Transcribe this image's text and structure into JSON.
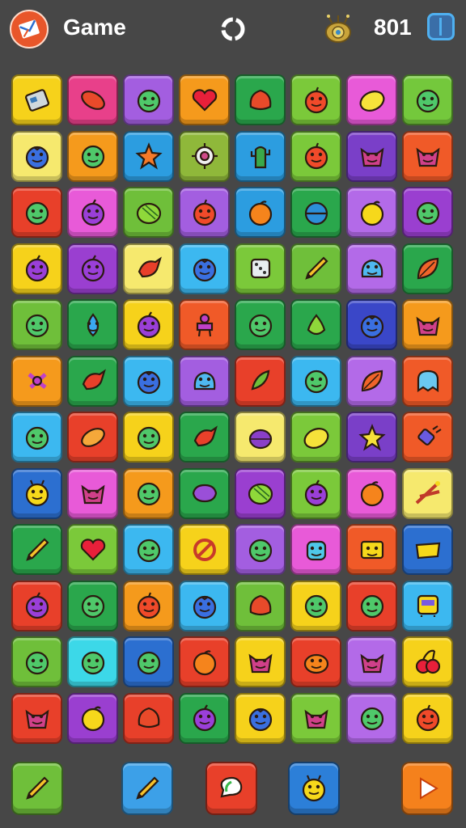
{
  "header": {
    "title": "Game",
    "coins": "801"
  },
  "board": {
    "rows": 12,
    "cols": 8,
    "tiles": [
      {
        "color": "#f6d21b",
        "icon": "robot"
      },
      {
        "color": "#e8408a",
        "icon": "fish"
      },
      {
        "color": "#a35ee0",
        "icon": "smiley"
      },
      {
        "color": "#f59a1c",
        "icon": "heart"
      },
      {
        "color": "#2aa74c",
        "icon": "leaf-creature"
      },
      {
        "color": "#7bc93a",
        "icon": "apple"
      },
      {
        "color": "#e85ad8",
        "icon": "lemon"
      },
      {
        "color": "#74c83c",
        "icon": "smiley"
      },
      {
        "color": "#f6e96e",
        "icon": "blueberry"
      },
      {
        "color": "#f59a1c",
        "icon": "smiley"
      },
      {
        "color": "#2c9de0",
        "icon": "star-creature"
      },
      {
        "color": "#8fb83a",
        "icon": "gear"
      },
      {
        "color": "#2c9de0",
        "icon": "cactus"
      },
      {
        "color": "#7bc93a",
        "icon": "apple"
      },
      {
        "color": "#7a3fc8",
        "icon": "cat"
      },
      {
        "color": "#f05a28",
        "icon": "cat"
      },
      {
        "color": "#e8402a",
        "icon": "smiley"
      },
      {
        "color": "#e85ad8",
        "icon": "plum"
      },
      {
        "color": "#6fbf3a",
        "icon": "melon"
      },
      {
        "color": "#a35ee0",
        "icon": "apple"
      },
      {
        "color": "#2c9de0",
        "icon": "orange"
      },
      {
        "color": "#2aa74c",
        "icon": "ball"
      },
      {
        "color": "#b36ae8",
        "icon": "lemon-round"
      },
      {
        "color": "#9a3fd0",
        "icon": "smiley"
      },
      {
        "color": "#f6d21b",
        "icon": "plum"
      },
      {
        "color": "#9a3fd0",
        "icon": "plum"
      },
      {
        "color": "#f6e96e",
        "icon": "bird"
      },
      {
        "color": "#3cb8f0",
        "icon": "blueberry"
      },
      {
        "color": "#7bc93a",
        "icon": "dice"
      },
      {
        "color": "#6fbf3a",
        "icon": "pencil"
      },
      {
        "color": "#b36ae8",
        "icon": "blob"
      },
      {
        "color": "#2aa74c",
        "icon": "leaf"
      },
      {
        "color": "#6fbf3a",
        "icon": "smiley"
      },
      {
        "color": "#2aa74c",
        "icon": "drop"
      },
      {
        "color": "#f6d21b",
        "icon": "plum"
      },
      {
        "color": "#f05a28",
        "icon": "robot-man"
      },
      {
        "color": "#2aa74c",
        "icon": "smiley"
      },
      {
        "color": "#2aa74c",
        "icon": "pear"
      },
      {
        "color": "#3a47c8",
        "icon": "blueberry"
      },
      {
        "color": "#f59a1c",
        "icon": "cat"
      },
      {
        "color": "#f59a1c",
        "icon": "bug"
      },
      {
        "color": "#2aa74c",
        "icon": "bird"
      },
      {
        "color": "#3cb8f0",
        "icon": "blueberry"
      },
      {
        "color": "#a35ee0",
        "icon": "blob"
      },
      {
        "color": "#e8402a",
        "icon": "corn"
      },
      {
        "color": "#3cb8f0",
        "icon": "smiley"
      },
      {
        "color": "#b36ae8",
        "icon": "leaf"
      },
      {
        "color": "#f05a28",
        "icon": "ghost"
      },
      {
        "color": "#3cb8f0",
        "icon": "smiley"
      },
      {
        "color": "#e8402a",
        "icon": "bread"
      },
      {
        "color": "#f6d21b",
        "icon": "smiley"
      },
      {
        "color": "#2aa74c",
        "icon": "bird"
      },
      {
        "color": "#f6e96e",
        "icon": "onion"
      },
      {
        "color": "#7bc93a",
        "icon": "lemon"
      },
      {
        "color": "#7a3fc8",
        "icon": "star"
      },
      {
        "color": "#f05a28",
        "icon": "plug"
      },
      {
        "color": "#2c6fd0",
        "icon": "chick"
      },
      {
        "color": "#e85ad8",
        "icon": "cat"
      },
      {
        "color": "#f59a1c",
        "icon": "smiley"
      },
      {
        "color": "#2aa74c",
        "icon": "pig"
      },
      {
        "color": "#9a3fd0",
        "icon": "melon"
      },
      {
        "color": "#7bc93a",
        "icon": "plum"
      },
      {
        "color": "#e85ad8",
        "icon": "orange"
      },
      {
        "color": "#f6e96e",
        "icon": "scissors"
      },
      {
        "color": "#2aa74c",
        "icon": "pencil"
      },
      {
        "color": "#7bc93a",
        "icon": "heart"
      },
      {
        "color": "#3cb8f0",
        "icon": "smiley"
      },
      {
        "color": "#f6d21b",
        "icon": "pretzel"
      },
      {
        "color": "#a35ee0",
        "icon": "smiley"
      },
      {
        "color": "#e85ad8",
        "icon": "robot-head"
      },
      {
        "color": "#f05a28",
        "icon": "box-face"
      },
      {
        "color": "#2c6fd0",
        "icon": "cheese"
      },
      {
        "color": "#e8402a",
        "icon": "plum"
      },
      {
        "color": "#2aa74c",
        "icon": "smiley"
      },
      {
        "color": "#f59a1c",
        "icon": "apple"
      },
      {
        "color": "#3cb8f0",
        "icon": "blueberry"
      },
      {
        "color": "#6fbf3a",
        "icon": "leaf-creature"
      },
      {
        "color": "#f6d21b",
        "icon": "smiley"
      },
      {
        "color": "#e8402a",
        "icon": "smiley"
      },
      {
        "color": "#3cb8f0",
        "icon": "bus"
      },
      {
        "color": "#6fbf3a",
        "icon": "smiley"
      },
      {
        "color": "#3cd8e8",
        "icon": "smiley"
      },
      {
        "color": "#2c6fd0",
        "icon": "smiley"
      },
      {
        "color": "#e8402a",
        "icon": "orange"
      },
      {
        "color": "#f6d21b",
        "icon": "cat"
      },
      {
        "color": "#e8402a",
        "icon": "pumpkin"
      },
      {
        "color": "#b36ae8",
        "icon": "cat"
      },
      {
        "color": "#f6d21b",
        "icon": "cherry"
      },
      {
        "color": "#e8402a",
        "icon": "cat"
      },
      {
        "color": "#9a3fd0",
        "icon": "lemon-round"
      },
      {
        "color": "#e8402a",
        "icon": "leaf-creature"
      },
      {
        "color": "#2aa74c",
        "icon": "plum"
      },
      {
        "color": "#f6d21b",
        "icon": "blueberry"
      },
      {
        "color": "#7bc93a",
        "icon": "cat"
      },
      {
        "color": "#b36ae8",
        "icon": "smiley"
      },
      {
        "color": "#f6d21b",
        "icon": "apple"
      }
    ]
  },
  "bottom_bar": {
    "buttons": [
      {
        "name": "pencil-button",
        "color": "#6fbf3a",
        "icon": "pencil"
      },
      {
        "name": "draw-button",
        "color": "#3ca0e8",
        "icon": "pencil"
      },
      {
        "name": "chat-button",
        "color": "#e8402a",
        "icon": "chat"
      },
      {
        "name": "hint-button",
        "color": "#2c7fd8",
        "icon": "chick"
      },
      {
        "name": "play-button",
        "color": "#f5811c",
        "icon": "play"
      }
    ]
  }
}
